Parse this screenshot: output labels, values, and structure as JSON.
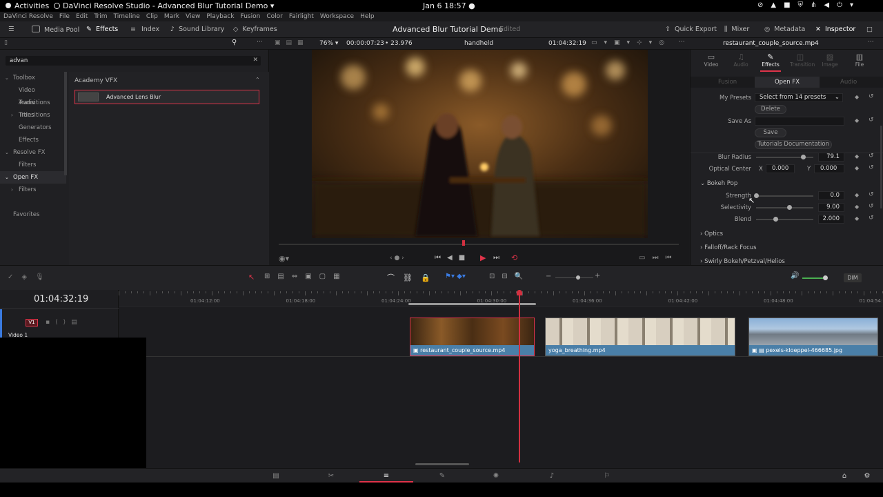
{
  "system": {
    "activities": "Activities",
    "app_title": "DaVinci Resolve Studio - Advanced Blur Tutorial Demo",
    "datetime": "Jan 6  18:57"
  },
  "menu": [
    "DaVinci Resolve",
    "File",
    "Edit",
    "Trim",
    "Timeline",
    "Clip",
    "Mark",
    "View",
    "Playback",
    "Fusion",
    "Color",
    "Fairlight",
    "Workspace",
    "Help"
  ],
  "toolbar": {
    "media_pool": "Media Pool",
    "effects": "Effects",
    "index": "Index",
    "sound_library": "Sound Library",
    "keyframes": "Keyframes",
    "project_title": "Advanced Blur Tutorial Demo",
    "project_status": "Edited",
    "quick_export": "Quick Export",
    "mixer": "Mixer",
    "metadata": "Metadata",
    "inspector": "Inspector"
  },
  "viewer": {
    "zoom": "76%",
    "duration": "00:00:07:23",
    "fps": "23.976",
    "clip_name": "handheld",
    "timecode": "01:04:32:19"
  },
  "effects": {
    "search_value": "advan",
    "tree": [
      {
        "label": "Toolbox",
        "open": true
      },
      {
        "label": "Video Transitions"
      },
      {
        "label": "Audio Transitions"
      },
      {
        "label": "Titles",
        "collapsed": true
      },
      {
        "label": "Generators"
      },
      {
        "label": "Effects"
      },
      {
        "label": "Resolve FX",
        "open": true
      },
      {
        "label": "Filters"
      },
      {
        "label": "Open FX",
        "open": true,
        "selected": true
      },
      {
        "label": "Filters",
        "collapsed": true
      }
    ],
    "favorites": "Favorites",
    "category": "Academy VFX",
    "result": "Advanced Lens Blur"
  },
  "inspector": {
    "clip_title": "restaurant_couple_source.mp4",
    "tabs": [
      "Video",
      "Audio",
      "Effects",
      "Transition",
      "Image",
      "File"
    ],
    "subtabs": [
      "Fusion",
      "Open FX",
      "Audio"
    ],
    "my_presets_label": "My Presets",
    "presets_value": "Select from 14 presets",
    "delete": "Delete",
    "save_as_label": "Save As",
    "save": "Save",
    "tutorials": "Tutorials Documentation",
    "blur_radius_label": "Blur Radius",
    "blur_radius": "79.1",
    "optical_center_label": "Optical Center",
    "x_label": "X",
    "y_label": "Y",
    "opt_x": "0.000",
    "opt_y": "0.000",
    "bokeh_pop": "Bokeh Pop",
    "strength_label": "Strength",
    "strength": "0.0",
    "selectivity_label": "Selectivity",
    "selectivity": "9.00",
    "blend_label": "Blend",
    "blend": "2.000",
    "optics": "Optics",
    "falloff": "Falloff/Rack Focus",
    "swirly": "Swirly Bokeh/Petzval/Helios"
  },
  "timeline": {
    "timecode": "01:04:32:19",
    "track": "V1",
    "track_name": "Video 1",
    "dim": "DIM",
    "ruler": [
      "01:04:12:00",
      "01:04:18:00",
      "01:04:24:00",
      "01:04:30:00",
      "01:04:36:00",
      "01:04:42:00",
      "01:04:48:00",
      "01:04:54:"
    ],
    "clips": [
      "restaurant_couple_source.mp4",
      "yoga_breathing.mp4",
      "pexels-kloeppel-466685.jpg"
    ]
  },
  "colors": {
    "accent": "#e0344a",
    "clip_blue": "#4a7fa8",
    "playhead": "#d23040"
  }
}
